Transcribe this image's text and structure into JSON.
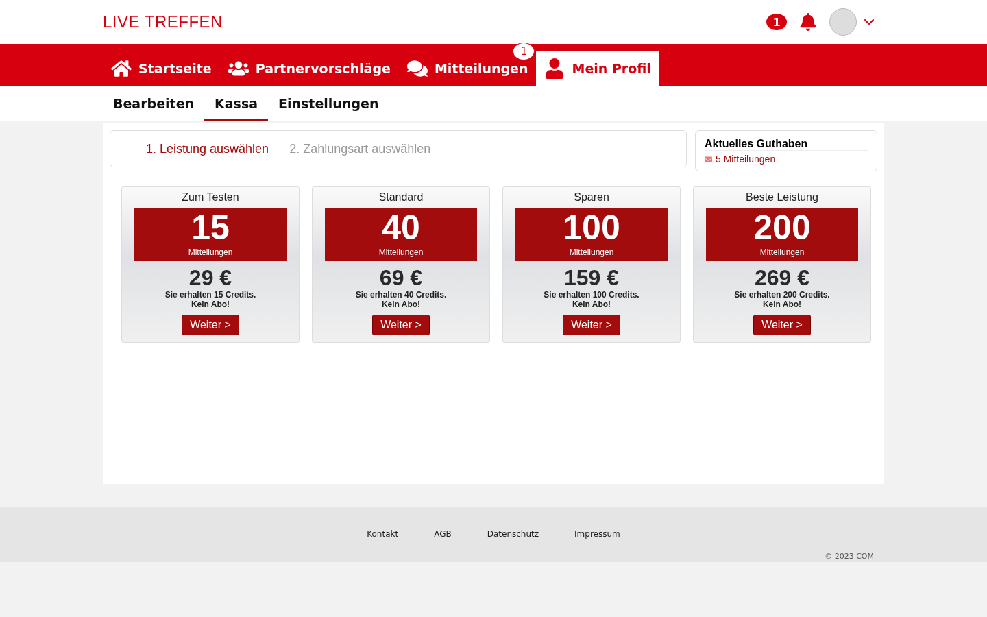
{
  "header": {
    "logo": "LIVE TREFFEN",
    "message_badge": "1"
  },
  "nav": [
    {
      "label": "Startseite",
      "selected": false
    },
    {
      "label": "Partnervorschläge",
      "selected": false
    },
    {
      "label": "Mitteilungen",
      "selected": false,
      "badge": "1"
    },
    {
      "label": "Mein Profil",
      "selected": true
    }
  ],
  "subnav": [
    {
      "label": "Bearbeiten",
      "selected": false
    },
    {
      "label": "Kassa",
      "selected": true
    },
    {
      "label": "Einstellungen",
      "selected": false
    }
  ],
  "steps": [
    {
      "label": "1. Leistung auswählen",
      "selected": true
    },
    {
      "label": "2. Zahlungsart auswählen",
      "selected": false
    }
  ],
  "balance": {
    "title": "Aktuelles Guthaben",
    "value": "5 Mitteilungen"
  },
  "packages": [
    {
      "name": "Zum Testen",
      "amount": "15",
      "unit": "Mitteilungen",
      "price": "29 €",
      "note": "Sie erhalten 15 Credits.",
      "note2": "Kein Abo!",
      "button": "Weiter >"
    },
    {
      "name": "Standard",
      "amount": "40",
      "unit": "Mitteilungen",
      "price": "69 €",
      "note": "Sie erhalten 40 Credits.",
      "note2": "Kein Abo!",
      "button": "Weiter >"
    },
    {
      "name": "Sparen",
      "amount": "100",
      "unit": "Mitteilungen",
      "price": "159 €",
      "note": "Sie erhalten 100 Credits.",
      "note2": "Kein Abo!",
      "button": "Weiter >"
    },
    {
      "name": "Beste Leistung",
      "amount": "200",
      "unit": "Mitteilungen",
      "price": "269 €",
      "note": "Sie erhalten 200 Credits.",
      "note2": "Kein Abo!",
      "button": "Weiter >"
    }
  ],
  "footer": {
    "links": [
      "Kontakt",
      "AGB",
      "Datenschutz",
      "Impressum"
    ],
    "copyright": "© 2023 COM"
  }
}
